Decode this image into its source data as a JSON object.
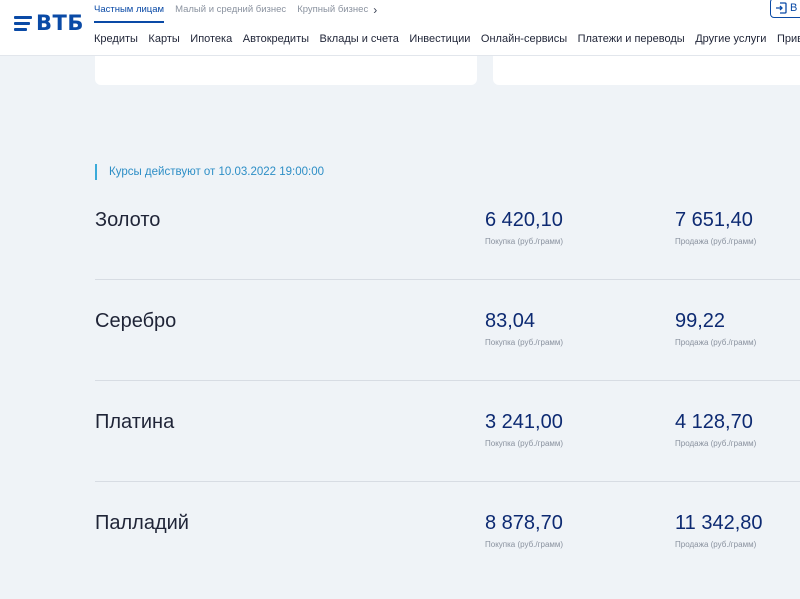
{
  "brand": {
    "name": "ВТБ",
    "color": "#0a4aa6"
  },
  "header": {
    "segments": [
      {
        "label": "Частным лицам",
        "active": true
      },
      {
        "label": "Малый и средний бизнес",
        "active": false
      },
      {
        "label": "Крупный бизнес",
        "active": false
      }
    ],
    "login_label": "В",
    "login_icon": "login-icon",
    "nav": [
      "Кредиты",
      "Карты",
      "Ипотека",
      "Автокредиты",
      "Вклады и счета",
      "Инвестиции",
      "Онлайн-сервисы",
      "Платежи и переводы",
      "Другие услуги",
      "Привиле"
    ]
  },
  "rates": {
    "note": "Курсы действуют от 10.03.2022 19:00:00",
    "buy_label": "Покупка (руб./грамм)",
    "sell_label": "Продажа (руб./грамм)",
    "metals": [
      {
        "name": "Золото",
        "buy": "6 420,10",
        "sell": "7 651,40"
      },
      {
        "name": "Серебро",
        "buy": "83,04",
        "sell": "99,22"
      },
      {
        "name": "Платина",
        "buy": "3 241,00",
        "sell": "4 128,70"
      },
      {
        "name": "Палладий",
        "buy": "8 878,70",
        "sell": "11 342,80"
      }
    ]
  }
}
